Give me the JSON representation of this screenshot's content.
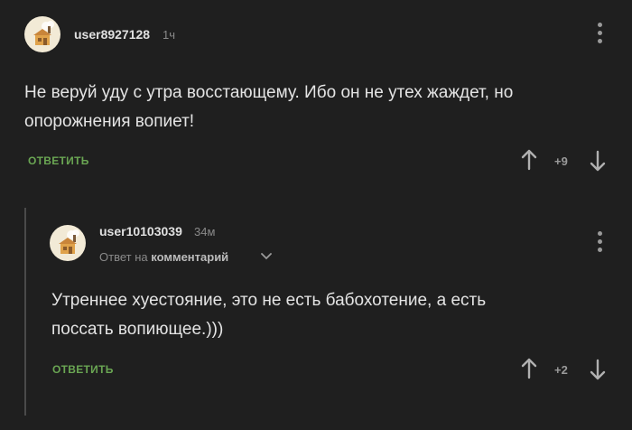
{
  "comments": [
    {
      "username": "user8927128",
      "time": "1ч",
      "text_lines": [
        "Не веруй уду с утра восстающему. Ибо он не утех жаждет, но",
        "опорожнения вопиет!"
      ],
      "reply_label": "ОТВЕТИТЬ",
      "rating": "+9"
    },
    {
      "username": "user10103039",
      "time": "34м",
      "reply_to_prefix": "Ответ на",
      "reply_to_target": "комментарий",
      "text_lines": [
        "Утреннее хуестояние, это не есть бабохотение, а есть",
        "поссать вопиющее.)))"
      ],
      "reply_label": "ОТВЕТИТЬ",
      "rating": "+2"
    }
  ],
  "icons": {
    "avatar": "house-avatar-icon",
    "menu": "more-vertical-icon",
    "upvote": "arrow-up-icon",
    "downvote": "arrow-down-icon",
    "expand": "chevron-down-icon"
  },
  "colors": {
    "background": "#1f1f1f",
    "accent": "#6aa653",
    "text": "#e4e4e4",
    "muted": "#8a8a8a"
  }
}
